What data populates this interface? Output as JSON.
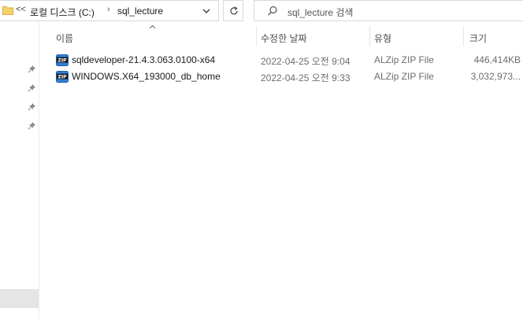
{
  "address_bar": {
    "overflow_label": "<<",
    "breadcrumbs": [
      "로컬 디스크 (C:)",
      "sql_lecture"
    ]
  },
  "search": {
    "placeholder": "sql_lecture 검색"
  },
  "columns": {
    "name": "이름",
    "date_modified": "수정한 날짜",
    "type": "유형",
    "size": "크기"
  },
  "files": [
    {
      "name": "sqldeveloper-21.4.3.063.0100-x64",
      "date_modified": "2022-04-25 오전 9:04",
      "type": "ALZip ZIP File",
      "size": "446,414KB",
      "icon": "zip-file-icon"
    },
    {
      "name": "WINDOWS.X64_193000_db_home",
      "date_modified": "2022-04-25 오전 9:33",
      "type": "ALZip ZIP File",
      "size": "3,032,973...",
      "icon": "zip-file-icon"
    }
  ],
  "colors": {
    "background": "#ffffff",
    "border": "#d9d9d9",
    "secondary_text": "#6d6d6d",
    "selected_nav": "#e5e5e5"
  }
}
